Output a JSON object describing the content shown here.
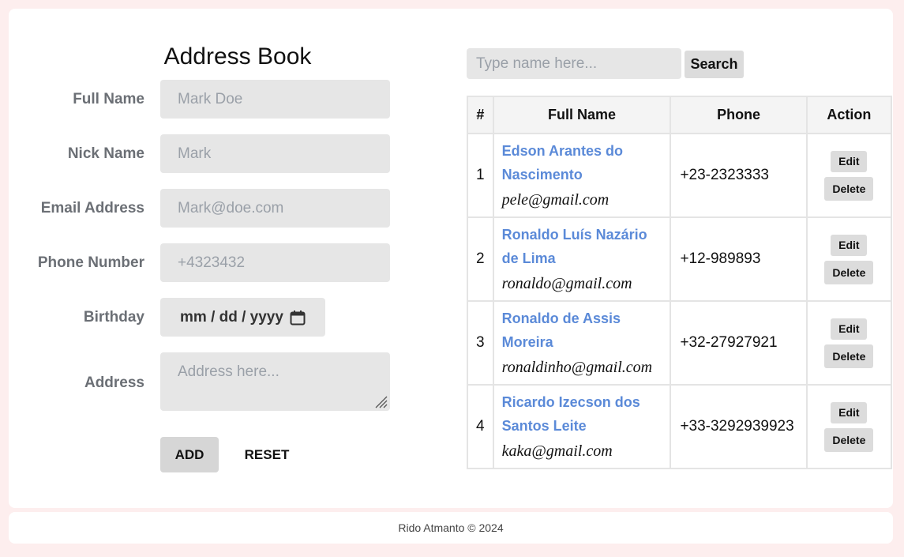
{
  "form": {
    "title": "Address Book",
    "fields": [
      {
        "label": "Full Name",
        "placeholder": "Mark Doe"
      },
      {
        "label": "Nick Name",
        "placeholder": "Mark"
      },
      {
        "label": "Email Address",
        "placeholder": "Mark@doe.com"
      },
      {
        "label": "Phone Number",
        "placeholder": "+4323432"
      }
    ],
    "birthday": {
      "label": "Birthday",
      "placeholder": "mm / dd / yyyy"
    },
    "address": {
      "label": "Address",
      "placeholder": "Address here..."
    },
    "add_label": "ADD",
    "reset_label": "RESET"
  },
  "search": {
    "placeholder": "Type name here...",
    "button_label": "Search"
  },
  "table": {
    "headers": [
      "#",
      "Full Name",
      "Phone",
      "Action"
    ],
    "rows": [
      {
        "num": "1",
        "name": "Edson Arantes do Nascimento",
        "email": "pele@gmail.com",
        "phone": "+23-2323333"
      },
      {
        "num": "2",
        "name": "Ronaldo Luís Nazário de Lima",
        "email": "ronaldo@gmail.com",
        "phone": "+12-989893"
      },
      {
        "num": "3",
        "name": "Ronaldo de Assis Moreira",
        "email": "ronaldinho@gmail.com",
        "phone": "+32-27927921"
      },
      {
        "num": "4",
        "name": "Ricardo Izecson dos Santos Leite",
        "email": "kaka@gmail.com",
        "phone": "+33-3292939923"
      }
    ],
    "edit_label": "Edit",
    "delete_label": "Delete"
  },
  "footer": {
    "text": "Rido Atmanto © 2024"
  },
  "colors": {
    "page_bg": "#fdeeee",
    "link": "#5b8ad8",
    "label": "#6b6f75"
  },
  "icons": {
    "birthday": "calendar-icon",
    "address": "resize-grip-icon"
  }
}
